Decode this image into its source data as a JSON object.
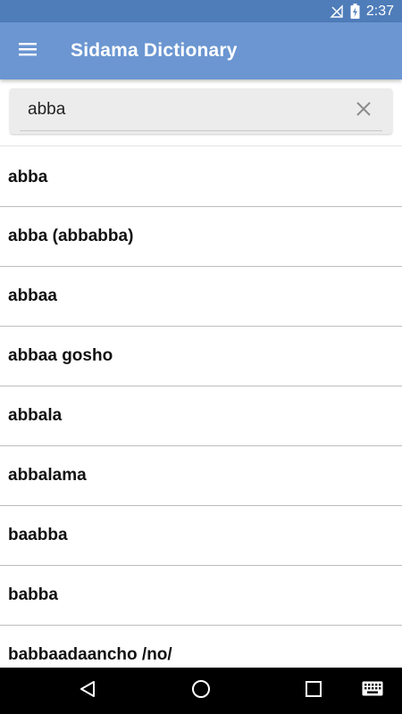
{
  "status_bar": {
    "time": "2:37",
    "icons": [
      "no-signal-icon",
      "battery-charging-icon"
    ]
  },
  "app_bar": {
    "title": "Sidama Dictionary",
    "menu_icon": "hamburger-menu-icon"
  },
  "search": {
    "value": "abba",
    "clear_icon": "close-icon"
  },
  "results": [
    "abba",
    "abba (abbabba)",
    "abbaa",
    "abbaa gosho",
    "abbala",
    "abbalama",
    "baabba",
    "babba",
    "babbaadaancho /no/"
  ],
  "nav_bar": {
    "icons": [
      "back-icon",
      "home-icon",
      "recents-icon",
      "keyboard-icon"
    ]
  },
  "colors": {
    "status_bar": "#4f7dba",
    "app_bar": "#6b96d1",
    "search_bg": "#ececec"
  }
}
